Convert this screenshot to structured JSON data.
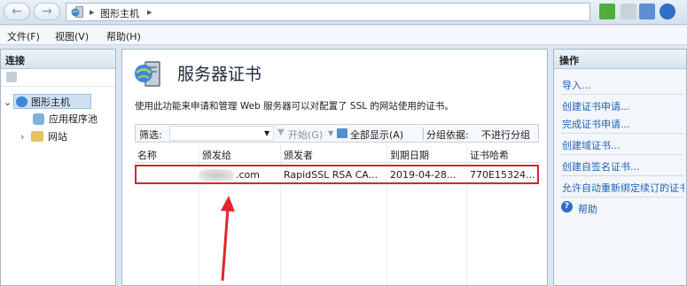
{
  "address": {
    "crumbs": [
      "图形主机",
      "▸"
    ],
    "back_glyph": "←",
    "forward_glyph": "→"
  },
  "menu": [
    "文件(F)",
    "视图(V)",
    "帮助(H)"
  ],
  "left_pane": {
    "title": "连接",
    "tree": [
      {
        "label": "图形主机",
        "toggle": "⌄"
      },
      {
        "label": "应用程序池"
      },
      {
        "label": "网站",
        "toggle": "›"
      }
    ]
  },
  "center": {
    "title": "服务器证书",
    "description": "使用此功能来申请和管理 Web 服务器可以对配置了 SSL 的网站使用的证书。",
    "filter": {
      "label": "筛选:",
      "start": "开始(G)",
      "show_all": "全部显示(A)",
      "group_by": "分组依据:",
      "group_value": "不进行分组"
    },
    "columns": [
      "名称",
      "颁发给",
      "颁发者",
      "到期日期",
      "证书哈希"
    ],
    "rows": [
      {
        "name": "",
        "issued_to": ".com",
        "issuer": "RapidSSL RSA CA...",
        "expiry": "2019-04-28...",
        "hash": "770E15324..."
      }
    ]
  },
  "right_pane": {
    "title": "操作",
    "items": [
      "导入...",
      "创建证书申请...",
      "完成证书申请...",
      "创建域证书...",
      "创建自签名证书...",
      "允许自动重新绑定续订的证书",
      "帮助"
    ]
  },
  "colors": {
    "highlight_border": "#d8262b",
    "link": "#1f62b8",
    "arrow": "#e0262c"
  }
}
